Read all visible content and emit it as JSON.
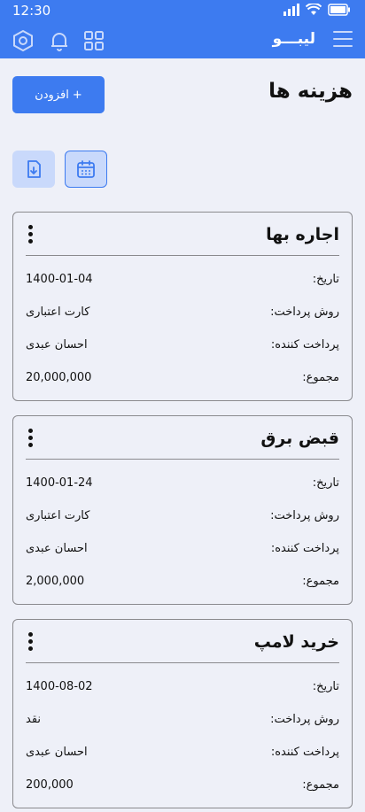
{
  "status_bar": {
    "time": "12:30"
  },
  "header": {
    "app_name": "لیبـــو"
  },
  "page": {
    "title": "هزینه ها",
    "add_button_label": "+ افزودن"
  },
  "labels": {
    "date": "تاریخ:",
    "payment_method": "روش پرداخت:",
    "payer": "پرداخت کننده:",
    "total": "مجموع:"
  },
  "expenses": [
    {
      "title": "اجاره بها",
      "date": "1400-01-04",
      "payment_method": "کارت اعتباری",
      "payer": "احسان عبدی",
      "total": "20,000,000"
    },
    {
      "title": "قبض برق",
      "date": "1400-01-24",
      "payment_method": "کارت اعتباری",
      "payer": "احسان عبدی",
      "total": "2,000,000"
    },
    {
      "title": "خرید لامپ",
      "date": "1400-08-02",
      "payment_method": "نقد",
      "payer": "احسان عبدی",
      "total": "200,000"
    }
  ],
  "colors": {
    "primary": "#3d7bf0",
    "background": "#eef0f8",
    "accent_light": "#c9d9fb"
  }
}
